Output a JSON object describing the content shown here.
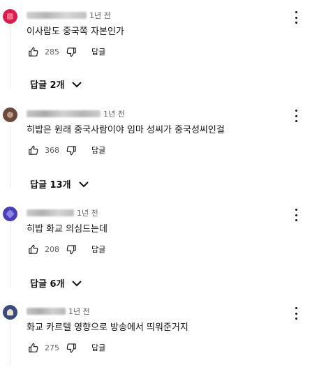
{
  "comments": [
    {
      "time": "1년 전",
      "text": "이사람도 중국쪽 자본인가",
      "likes": "285",
      "reply_label": "답글",
      "replies_label": "답글 2개",
      "avatar_color": "#d91e4f",
      "avatar_icon": "user-avatar"
    },
    {
      "time": "1년 전",
      "text": "히밥은 원래 중국사람이야 임마 성씨가 중국성씨인걸",
      "likes": "368",
      "reply_label": "답글",
      "replies_label": "답글 13개",
      "avatar_color": "#6b4a3e",
      "avatar_icon": "user-avatar"
    },
    {
      "time": "1년 전",
      "text": "히밥 화교 의심드는데",
      "likes": "208",
      "reply_label": "답글",
      "replies_label": "답글 6개",
      "avatar_color": "#4b3fb5",
      "avatar_icon": "user-avatar"
    },
    {
      "time": "1년 전",
      "text": "화교 카르텔 영향으로 방송에서 띄워준거지",
      "likes": "275",
      "reply_label": "답글",
      "avatar_color": "#3a4a7a",
      "avatar_icon": "user-avatar"
    }
  ],
  "icons": {
    "like": "thumbs-up-icon",
    "dislike": "thumbs-down-icon",
    "menu": "more-vert-icon",
    "expand": "chevron-down-icon"
  }
}
